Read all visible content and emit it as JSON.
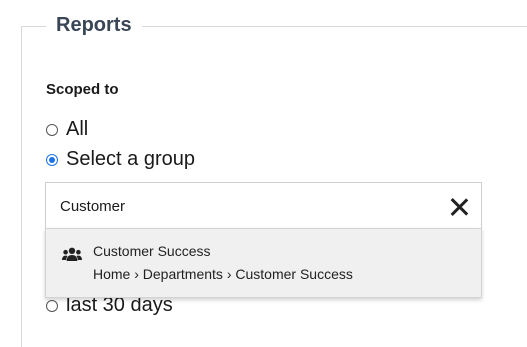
{
  "section": {
    "title": "Reports"
  },
  "scope": {
    "label": "Scoped to",
    "options": [
      {
        "label": "All",
        "checked": false
      },
      {
        "label": "Select a group",
        "checked": true
      }
    ]
  },
  "search": {
    "value": "Customer"
  },
  "suggestion": {
    "title": "Customer Success",
    "path": "Home › Departments › Customer Success"
  },
  "period": {
    "option_label": "last 30 days"
  },
  "colors": {
    "accent": "#1a73e8",
    "heading": "#3a4656"
  }
}
